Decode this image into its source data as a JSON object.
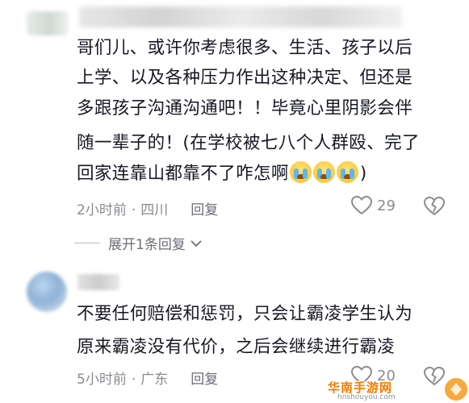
{
  "comment1": {
    "lines": [
      "哥们儿、或许你考虑很多、生活、孩子以后",
      "上学、以及各种压力作出这种决定、但还是",
      "多跟孩子沟通沟通吧！！毕竟心里阴影会伴",
      "随一辈子的！(在学校被七八个人群殴、完了",
      "回家连靠山都靠不了咋怎啊"
    ],
    "closing": ")",
    "time": "2小时前",
    "separator": "·",
    "location": "四川",
    "reply_label": "回复",
    "likes": "29"
  },
  "expand_replies": {
    "label": "展开1条回复"
  },
  "comment2": {
    "lines": [
      "不要任何赔偿和惩罚，只会让霸凌学生认为",
      "原来霸凌没有代价，之后会继续进行霸凌"
    ],
    "time": "5小时前",
    "separator": "·",
    "location": "广东",
    "reply_label": "回复",
    "likes": "20"
  },
  "watermark": {
    "title": "华南手游网",
    "subtitle": "hnshouyou.com"
  },
  "colors": {
    "text": "#161823",
    "meta": "#8a8b91",
    "watermark": "#f27b00"
  },
  "icons": {
    "like": "heart-icon",
    "dislike": "broken-heart-icon",
    "expand": "chevron-down-icon",
    "emoji": "loudly-crying-face-emoji"
  }
}
